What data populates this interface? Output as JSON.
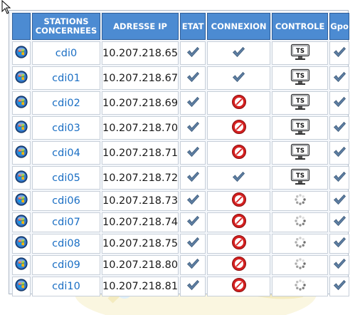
{
  "headers": {
    "icon": "",
    "stations": "STATIONS CONCERNEES",
    "ip": "ADRESSE IP",
    "etat": "ETAT",
    "connexion": "CONNEXION",
    "controle": "CONTROLE",
    "gpo": "Gpo"
  },
  "rows": [
    {
      "name": "cdi0",
      "ip": "10.207.218.65",
      "etat": "check",
      "connexion": "check",
      "controle": "ts",
      "gpo": "check"
    },
    {
      "name": "cdi01",
      "ip": "10.207.218.67",
      "etat": "check",
      "connexion": "check",
      "controle": "ts",
      "gpo": "check"
    },
    {
      "name": "cdi02",
      "ip": "10.207.218.69",
      "etat": "check",
      "connexion": "blocked",
      "controle": "ts",
      "gpo": "check"
    },
    {
      "name": "cdi03",
      "ip": "10.207.218.70",
      "etat": "check",
      "connexion": "blocked",
      "controle": "ts",
      "gpo": "check"
    },
    {
      "name": "cdi04",
      "ip": "10.207.218.71",
      "etat": "check",
      "connexion": "blocked",
      "controle": "ts",
      "gpo": "check"
    },
    {
      "name": "cdi05",
      "ip": "10.207.218.72",
      "etat": "check",
      "connexion": "check",
      "controle": "ts",
      "gpo": "check"
    },
    {
      "name": "cdi06",
      "ip": "10.207.218.73",
      "etat": "check",
      "connexion": "blocked",
      "controle": "loading",
      "gpo": "check"
    },
    {
      "name": "cdi07",
      "ip": "10.207.218.74",
      "etat": "check",
      "connexion": "blocked",
      "controle": "loading",
      "gpo": "check"
    },
    {
      "name": "cdi08",
      "ip": "10.207.218.75",
      "etat": "check",
      "connexion": "blocked",
      "controle": "loading",
      "gpo": "check"
    },
    {
      "name": "cdi09",
      "ip": "10.207.218.80",
      "etat": "check",
      "connexion": "blocked",
      "controle": "loading",
      "gpo": "check"
    },
    {
      "name": "cdi10",
      "ip": "10.207.218.81",
      "etat": "check",
      "connexion": "blocked",
      "controle": "loading",
      "gpo": "check"
    }
  ],
  "ts_label": "TS",
  "colors": {
    "header_bg": "#4c8bd2",
    "link": "#1b6fc4",
    "check": "#5e7fa3",
    "blocked": "#d42020"
  },
  "icons": {
    "os": "windows7-orb-icon",
    "check": "checkmark-icon",
    "blocked": "no-entry-icon",
    "ts": "terminal-screen-icon",
    "loading": "loading-spinner-icon"
  }
}
